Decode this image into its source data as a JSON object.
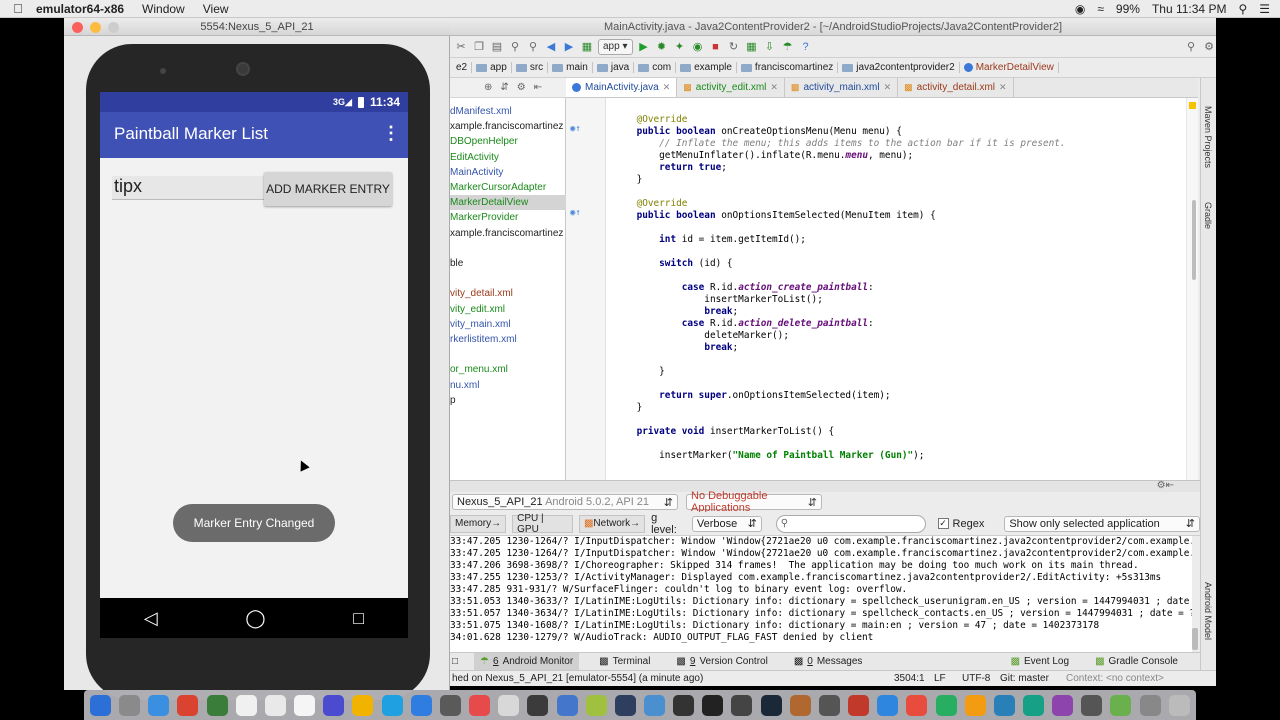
{
  "menubar": {
    "app_name": "emulator64-x86",
    "items": [
      "Window",
      "View"
    ],
    "battery": "99%",
    "clock": "Thu 11:34 PM"
  },
  "emulator": {
    "window_title": "5554:Nexus_5_API_21",
    "status_clock": "11:34",
    "app_title": "Paintball Marker List",
    "edit_value": "tipx",
    "add_button": "ADD MARKER ENTRY",
    "toast": "Marker Entry Changed"
  },
  "studio": {
    "window_title": "MainActivity.java - Java2ContentProvider2 - [~/AndroidStudioProjects/Java2ContentProvider2]",
    "run_config": "app",
    "breadcrumbs": [
      "e2",
      "app",
      "src",
      "main",
      "java",
      "com",
      "example",
      "franciscomartinez",
      "java2contentprovider2",
      "MarkerDetailView"
    ],
    "tree": [
      {
        "text": "dManifest.xml",
        "color": "#3355aa"
      },
      {
        "text": "xample.franciscomartinez",
        "color": "#222"
      },
      {
        "text": "DBOpenHelper",
        "color": "#1a8a1a"
      },
      {
        "text": "EditActivity",
        "color": "#1a8a1a"
      },
      {
        "text": "MainActivity",
        "color": "#3355aa"
      },
      {
        "text": "MarkerCursorAdapter",
        "color": "#1a8a1a"
      },
      {
        "text": "MarkerDetailView",
        "color": "#1a8a1a",
        "selected": true
      },
      {
        "text": "MarkerProvider",
        "color": "#1a8a1a"
      },
      {
        "text": "xample.franciscomartinez",
        "color": "#222"
      },
      {
        "text": "",
        "color": "#222"
      },
      {
        "text": "ble",
        "color": "#222"
      },
      {
        "text": "",
        "color": "#222"
      },
      {
        "text": "vity_detail.xml",
        "color": "#9a3a1a"
      },
      {
        "text": "vity_edit.xml",
        "color": "#1a8a1a"
      },
      {
        "text": "vity_main.xml",
        "color": "#3355aa"
      },
      {
        "text": "rkerlistitem.xml",
        "color": "#3355aa"
      },
      {
        "text": "",
        "color": "#222"
      },
      {
        "text": "or_menu.xml",
        "color": "#1a8a1a"
      },
      {
        "text": "nu.xml",
        "color": "#3355aa"
      },
      {
        "text": "p",
        "color": "#222"
      }
    ],
    "tabs": [
      {
        "label": "MainActivity.java",
        "active": true
      },
      {
        "label": "activity_edit.xml",
        "active": false
      },
      {
        "label": "activity_main.xml",
        "active": false
      },
      {
        "label": "activity_detail.xml",
        "active": false
      }
    ],
    "side_labels": [
      "Maven Projects",
      "Gradle",
      "Android Model"
    ],
    "device": "Nexus_5_API_21",
    "device_detail": "Android 5.0.2, API 21",
    "debug_apps": "No Debuggable Applications",
    "monitor_tabs": [
      "Memory",
      "CPU | GPU",
      "Network"
    ],
    "log_level_label": "g level:",
    "log_level": "Verbose",
    "regex_label": "Regex",
    "filter": "Show only selected application",
    "log_lines": [
      "33:47.205 1230-1264/? I/InputDispatcher: Window 'Window{2721ae20 u0 com.example.franciscomartinez.java2contentprovider2/com.example.f",
      "33:47.205 1230-1264/? I/InputDispatcher: Window 'Window{2721ae20 u0 com.example.franciscomartinez.java2contentprovider2/com.example.f",
      "33:47.206 3698-3698/? I/Choreographer: Skipped 314 frames!  The application may be doing too much work on its main thread.",
      "33:47.255 1230-1253/? I/ActivityManager: Displayed com.example.franciscomartinez.java2contentprovider2/.EditActivity: +5s313ms",
      "33:47.285 931-931/? W/SurfaceFlinger: couldn't log to binary event log: overflow.",
      "33:51.053 1340-3633/? I/LatinIME:LogUtils: Dictionary info: dictionary = spellcheck_userunigram.en_US ; version = 1447994031 ; date =",
      "33:51.057 1340-3634/? I/LatinIME:LogUtils: Dictionary info: dictionary = spellcheck_contacts.en_US ; version = 1447994031 ; date = ?",
      "33:51.075 1340-1608/? I/LatinIME:LogUtils: Dictionary info: dictionary = main:en ; version = 47 ; date = 1402373178",
      "34:01.628 1230-1279/? W/AudioTrack: AUDIO_OUTPUT_FLAG_FAST denied by client"
    ],
    "tool_tabs": [
      "Android Monitor",
      "Terminal",
      "Version Control",
      "Messages"
    ],
    "tool_tab_nums": [
      "6",
      "",
      "9",
      "0"
    ],
    "right_tools": [
      "Event Log",
      "Gradle Console"
    ],
    "status_message": "hed on Nexus_5_API_21 [emulator-5554] (a minute ago)",
    "position": "3504:1",
    "line_sep": "LF",
    "encoding": "UTF-8",
    "vcs": "Git: master",
    "context": "Context: <no context>"
  },
  "dock_colors": [
    "#2c6fd6",
    "#8a8a8a",
    "#3b8fe0",
    "#d9432f",
    "#3a7d3a",
    "#f0f0f0",
    "#e9e9e9",
    "#f5f5f5",
    "#4b4bd0",
    "#f1b300",
    "#1fa0e0",
    "#2f7de0",
    "#5a5a5a",
    "#e64a4a",
    "#d8d8d8",
    "#3b3b3b",
    "#4477cc",
    "#a0c040",
    "#2e3e5e",
    "#4a90d0",
    "#333",
    "#222",
    "#444",
    "#1b2838",
    "#b06830",
    "#555",
    "#c0392b",
    "#2e86de",
    "#e74c3c",
    "#27ae60",
    "#f39c12",
    "#2980b9",
    "#16a085",
    "#8e44ad",
    "#555",
    "#6ab04c",
    "#888",
    "#bbb"
  ],
  "text_colors": {
    "keyword": "#000080",
    "annotation": "#808000",
    "comment": "#808080",
    "field": "#660e7a",
    "string": "#008000"
  }
}
